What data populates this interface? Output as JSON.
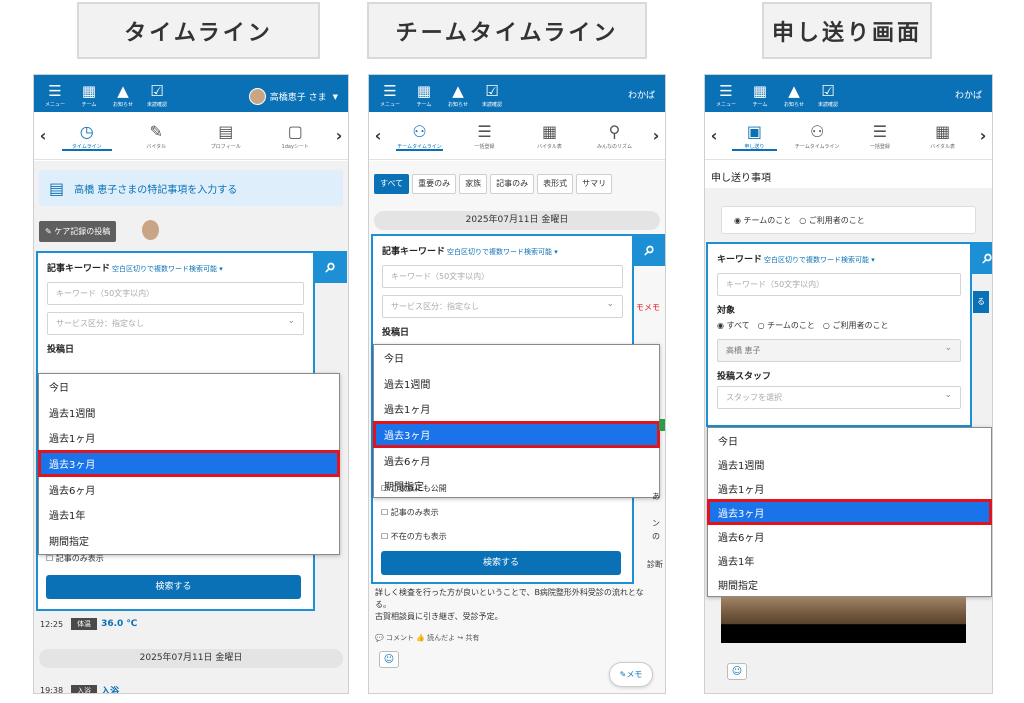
{
  "titles": [
    "タイムライン",
    "チームタイムライン",
    "申し送り画面"
  ],
  "appbar": {
    "items": [
      {
        "icon": "menu-icon",
        "glyph": "☰",
        "label": "メニュー"
      },
      {
        "icon": "team-icon",
        "glyph": "▦",
        "label": "チーム"
      },
      {
        "icon": "bell-icon",
        "glyph": "▲",
        "label": "お知らせ"
      },
      {
        "icon": "clipboard-check-icon",
        "glyph": "☑",
        "label": "未読確認"
      }
    ],
    "user1": "高橋恵子 さま",
    "user_company": "わかば"
  },
  "colors": {
    "primary": "#0b71b6",
    "highlight": "#1a73e8",
    "annotation_red": "#e0141e"
  },
  "screen1": {
    "tabs": [
      "タイムライン",
      "バイタル",
      "プロフィール",
      "1dayシート"
    ],
    "sticky": "高橋 恵子さまの特記事項を入力する",
    "care_button": "ケア記録の投稿",
    "check_article_only": "☐ 記事のみ表示",
    "search_button": "検索する",
    "record": {
      "time": "12:25",
      "badge": "体温",
      "value": "36.0 ℃"
    },
    "date_bar": "2025年07月11日 金曜日",
    "record2": {
      "time": "19:38",
      "badge": "入浴",
      "value": "入浴"
    }
  },
  "screen2": {
    "tabs": [
      "チームタイムライン",
      "一括登録",
      "バイタル表",
      "みんなのリズム"
    ],
    "filters": [
      "すべて",
      "重要のみ",
      "家族",
      "記事のみ",
      "表形式",
      "サマリ"
    ],
    "date_bar": "2025年07月11日 金曜日",
    "check_family": "☐ ご家族にも公開",
    "check_article_only": "☐ 記事のみ表示",
    "check_absent": "☐ 不在の方も表示",
    "search_button": "検索する",
    "side_memo": "モメモ",
    "side_frag1": "あ",
    "side_frag2": "ン",
    "side_frag3": "の",
    "side_frag4": "診断",
    "post_text": "詳しく検査を行った方が良いということで、B病院整形外科受診の流れとなる。",
    "post_text2": "古賀相談員に引き継ぎ、受診予定。",
    "post_actions": "💬 コメント 👍 読んだよ ↪ 共有",
    "memo_button": "✎メモ"
  },
  "screen3": {
    "tabs": [
      "申し送り",
      "チームタイムライン",
      "一括登録",
      "バイタル表"
    ],
    "section_title": "申し送り事項",
    "radio_box": "◉ チームのこと　○ ご利用者のこと",
    "target_label": "対象",
    "target_radios": "◉ すべて　○ チームのこと　○ ご利用者のこと",
    "person_select": "高橋 恵子",
    "staff_label": "投稿スタッフ",
    "staff_placeholder": "スタッフを選択",
    "side_button": "る"
  },
  "search": {
    "keyword_label": "記事キーワード",
    "keyword_label3": "キーワード",
    "keyword_hint": "空白区切りで複数ワード検索可能 ▾",
    "keyword_placeholder": "キーワード（50文字以内）",
    "service_placeholder": "サービス区分：指定なし",
    "date_label": "投稿日"
  },
  "date_options_full": [
    "今日",
    "過去1週間",
    "過去1ヶ月",
    "過去3ヶ月",
    "過去6ヶ月",
    "過去1年",
    "期間指定"
  ],
  "date_options_short": [
    "今日",
    "過去1週間",
    "過去1ヶ月",
    "過去3ヶ月",
    "過去6ヶ月",
    "期間指定"
  ],
  "selected_option": "過去3ヶ月"
}
